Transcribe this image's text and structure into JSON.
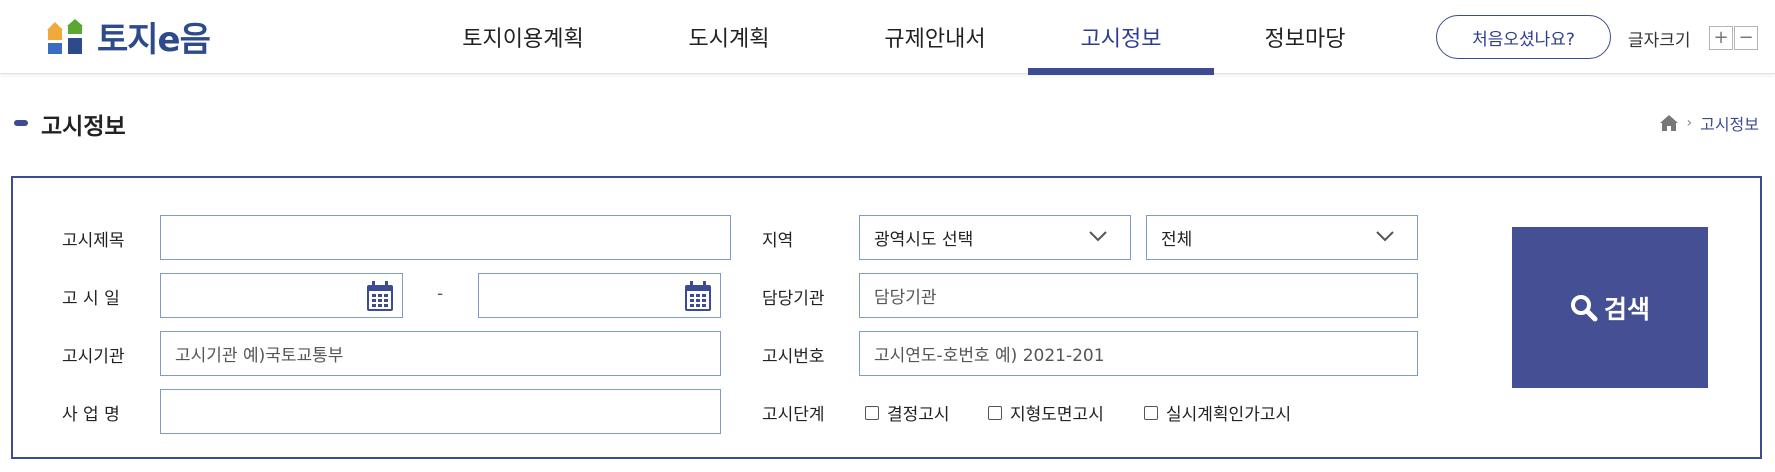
{
  "logo": {
    "text": "토지e음"
  },
  "nav": {
    "items": [
      {
        "label": "토지이용계획"
      },
      {
        "label": "도시계획"
      },
      {
        "label": "규제안내서"
      },
      {
        "label": "고시정보",
        "active": true
      },
      {
        "label": "정보마당"
      }
    ]
  },
  "header": {
    "first_visit_label": "처음오셨나요?",
    "font_size_label": "글자크기",
    "font_plus": "+",
    "font_minus": "−"
  },
  "page": {
    "title": "고시정보"
  },
  "breadcrumb": {
    "home_icon": "home-icon",
    "separator": "›",
    "current": "고시정보"
  },
  "search": {
    "title_label": "고시제목",
    "title_value": "",
    "date_label": "고 시 일",
    "date_from": "",
    "date_to": "",
    "date_separator": "-",
    "agency_label": "고시기관",
    "agency_placeholder": "고시기관  예)국토교통부",
    "project_label": "사 업 명",
    "project_value": "",
    "region_label": "지역",
    "region_province": "광역시도 선택",
    "region_city": "전체",
    "manager_label": "담당기관",
    "manager_placeholder": "담당기관",
    "number_label": "고시번호",
    "number_placeholder": "고시연도-호번호  예) 2021-201",
    "stage_label": "고시단계",
    "stages": [
      {
        "label": "결정고시",
        "checked": false
      },
      {
        "label": "지형도면고시",
        "checked": false
      },
      {
        "label": "실시계획인가고시",
        "checked": false
      }
    ],
    "search_button": "검색"
  },
  "colors": {
    "primary": "#3c4b94",
    "border": "#7f9bc8",
    "button": "#444f94"
  }
}
